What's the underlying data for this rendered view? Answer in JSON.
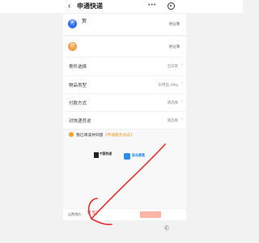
{
  "topbar": {
    "back_icon": "back-arrow-icon",
    "title": "申通快递",
    "more_icon": "more-dots-icon",
    "target_icon": "target-icon"
  },
  "sender": {
    "badge": "寄",
    "name": "贺",
    "detail": "",
    "address_book": "地址簿"
  },
  "receiver": {
    "badge": "收",
    "name": "",
    "detail": "",
    "address_book": "地址簿"
  },
  "options": [
    {
      "label": "寄件选择",
      "value": "当日寄"
    },
    {
      "label": "物品类型",
      "value": "日用品 10kg"
    },
    {
      "label": "付款方式",
      "value": "请选择"
    },
    {
      "label": "对快递员说",
      "value": "请选择"
    }
  ],
  "agreement": {
    "text": "我已阅读并同意",
    "link": "《申通服务协议》"
  },
  "logos": {
    "left_title": "中国快递",
    "left_sub": "",
    "right_title": "菜鸟裹裹",
    "right_sub": ""
  },
  "estimate": {
    "label": "运费预估",
    "value": "¥ 57"
  },
  "watermark": "Ⓒ"
}
